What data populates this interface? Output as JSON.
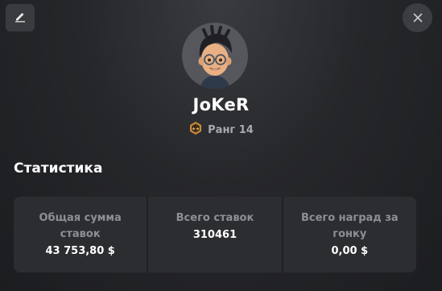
{
  "profile": {
    "username": "JoKeR",
    "rank_label": "Ранг 14"
  },
  "stats_section": {
    "title": "Статистика",
    "items": [
      {
        "label": "Общая сумма ставок",
        "value": "43 753,80 $"
      },
      {
        "label": "Всего ставок",
        "value": "310461"
      },
      {
        "label": "Всего наград за гонку",
        "value": "0,00 $"
      }
    ]
  },
  "icons": {
    "edit": "pencil-icon",
    "close": "close-icon",
    "rank": "rank-badge-icon"
  },
  "colors": {
    "background": "#1c1d20",
    "card": "#2c2d31",
    "muted_text": "#8e8f95",
    "rank_badge": "#c9893b"
  }
}
